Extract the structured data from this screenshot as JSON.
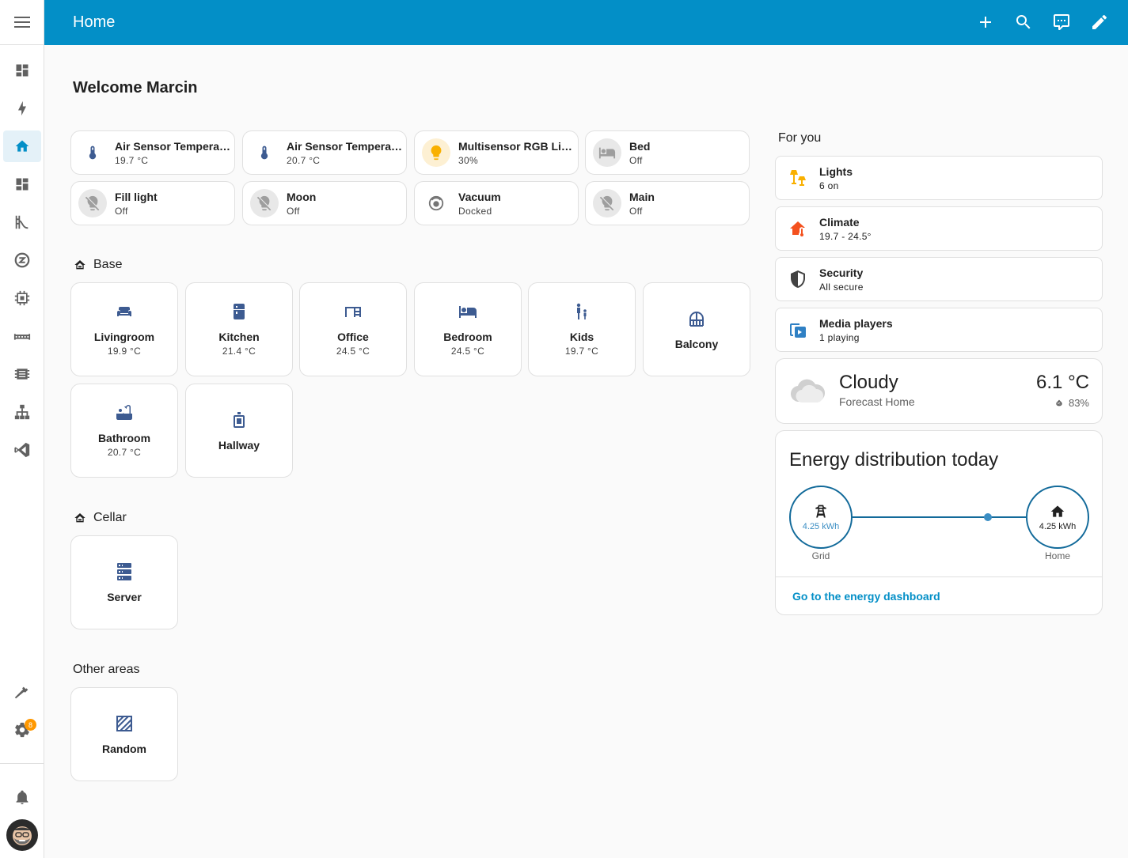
{
  "header": {
    "title": "Home",
    "color": "#038fc7"
  },
  "sidebar": {
    "items": [
      {
        "icon": "dashboard-icon"
      },
      {
        "icon": "lightning-icon"
      },
      {
        "icon": "home-icon",
        "active": true
      },
      {
        "icon": "dashboard-icon"
      },
      {
        "icon": "slide-icon"
      },
      {
        "icon": "zwave-icon"
      },
      {
        "icon": "chip-icon"
      },
      {
        "icon": "bridge-icon"
      },
      {
        "icon": "memory-icon"
      },
      {
        "icon": "sitemap-icon"
      },
      {
        "icon": "vscode-icon"
      }
    ],
    "bottom": [
      {
        "icon": "hammer-icon"
      },
      {
        "icon": "gear-icon",
        "badge": "8"
      },
      {
        "icon": "bell-icon"
      }
    ]
  },
  "welcome": "Welcome Marcin",
  "tiles": [
    {
      "name": "Air Sensor Temperature",
      "state": "19.7 °C"
    },
    {
      "name": "Air Sensor Temperature",
      "state": "20.7 °C"
    },
    {
      "name": "Multisensor RGB Light",
      "state": "30%"
    },
    {
      "name": "Bed",
      "state": "Off"
    },
    {
      "name": "Fill light",
      "state": "Off"
    },
    {
      "name": "Moon",
      "state": "Off"
    },
    {
      "name": "Vacuum",
      "state": "Docked"
    },
    {
      "name": "Main",
      "state": "Off"
    }
  ],
  "floors": {
    "base": {
      "title": "Base",
      "areas": [
        {
          "name": "Livingroom",
          "temp": "19.9 °C"
        },
        {
          "name": "Kitchen",
          "temp": "21.4 °C"
        },
        {
          "name": "Office",
          "temp": "24.5 °C"
        },
        {
          "name": "Bedroom",
          "temp": "24.5 °C"
        },
        {
          "name": "Kids",
          "temp": "19.7 °C"
        },
        {
          "name": "Balcony",
          "temp": ""
        },
        {
          "name": "Bathroom",
          "temp": "20.7 °C"
        },
        {
          "name": "Hallway",
          "temp": ""
        }
      ]
    },
    "cellar": {
      "title": "Cellar",
      "areas": [
        {
          "name": "Server",
          "temp": ""
        }
      ]
    },
    "other": {
      "title": "Other areas",
      "areas": [
        {
          "name": "Random",
          "temp": ""
        }
      ]
    }
  },
  "for_you": {
    "title": "For you",
    "summaries": [
      {
        "name": "Lights",
        "state": "6 on",
        "color": "#f9b000"
      },
      {
        "name": "Climate",
        "state": "19.7 - 24.5°",
        "color": "#f4511e"
      },
      {
        "name": "Security",
        "state": "All secure",
        "color": "#424242"
      },
      {
        "name": "Media players",
        "state": "1 playing",
        "color": "#2f80c4"
      }
    ]
  },
  "weather": {
    "condition": "Cloudy",
    "subtitle": "Forecast Home",
    "temperature": "6.1 °C",
    "humidity": "83%"
  },
  "energy": {
    "title": "Energy distribution today",
    "grid_value": "4.25 kWh",
    "grid_label": "Grid",
    "home_value": "4.25 kWh",
    "home_label": "Home",
    "link": "Go to the energy dashboard"
  }
}
